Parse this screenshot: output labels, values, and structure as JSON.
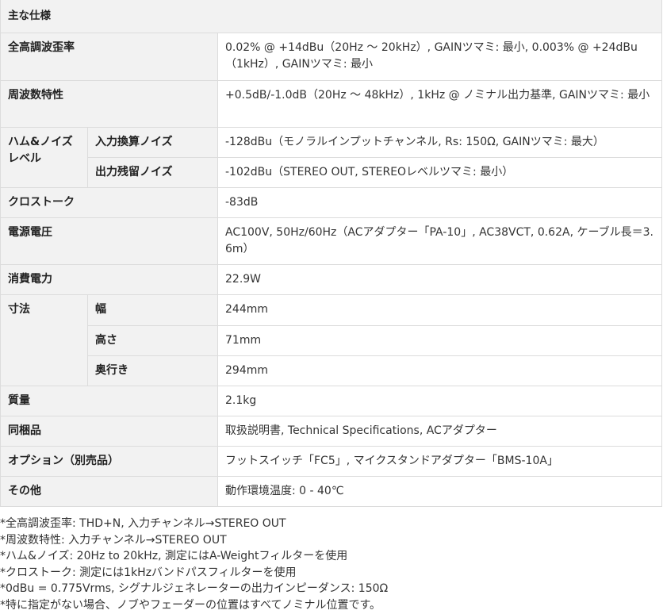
{
  "spec": {
    "caption": "主な仕様",
    "rows": {
      "thd": {
        "label": "全高調波歪率",
        "value": "0.02% @ +14dBu（20Hz 〜 20kHz）, GAINツマミ: 最小, 0.003% @ +24dBu（1kHz）, GAINツマミ: 最小"
      },
      "freq": {
        "label": "周波数特性",
        "value": "+0.5dB/-1.0dB（20Hz 〜 48kHz）, 1kHz @ ノミナル出力基準, GAINツマミ: 最小"
      },
      "hum": {
        "label": "ハム&ノイズレベル",
        "sub1_label": "入力換算ノイズ",
        "sub1_value": "-128dBu（モノラルインプットチャンネル, Rs: 150Ω, GAINツマミ: 最大）",
        "sub2_label": "出力残留ノイズ",
        "sub2_value": "-102dBu（STEREO OUT, STEREOレベルツマミ: 最小）"
      },
      "crosstalk": {
        "label": "クロストーク",
        "value": "-83dB"
      },
      "power_supply": {
        "label": "電源電圧",
        "value": "AC100V, 50Hz/60Hz（ACアダプター「PA-10」, AC38VCT, 0.62A, ケーブル長＝3.6m）"
      },
      "power_consumption": {
        "label": "消費電力",
        "value": "22.9W"
      },
      "dimensions": {
        "label": "寸法",
        "width_label": "幅",
        "width_value": "244mm",
        "height_label": "高さ",
        "height_value": "71mm",
        "depth_label": "奥行き",
        "depth_value": "294mm"
      },
      "weight": {
        "label": "質量",
        "value": "2.1kg"
      },
      "accessories": {
        "label": "同梱品",
        "value": "取扱説明書, Technical Specifications, ACアダプター"
      },
      "options": {
        "label": "オプション（別売品）",
        "value": "フットスイッチ「FC5」, マイクスタンドアダプター「BMS-10A」"
      },
      "other": {
        "label": "その他",
        "value": "動作環境温度: 0 - 40℃"
      }
    }
  },
  "notes": [
    "*全高調波歪率: THD+N, 入力チャンネル→STEREO OUT",
    "*周波数特性: 入力チャンネル→STEREO OUT",
    "*ハム&ノイズ: 20Hz to 20kHz, 測定にはA-Weightフィルターを使用",
    "*クロストーク: 測定には1kHzバンドパスフィルターを使用",
    "*0dBu = 0.775Vrms, シグナルジェネレーターの出力インピーダンス: 150Ω",
    "*特に指定がない場合、ノブやフェーダーの位置はすべてノミナル位置です。"
  ]
}
